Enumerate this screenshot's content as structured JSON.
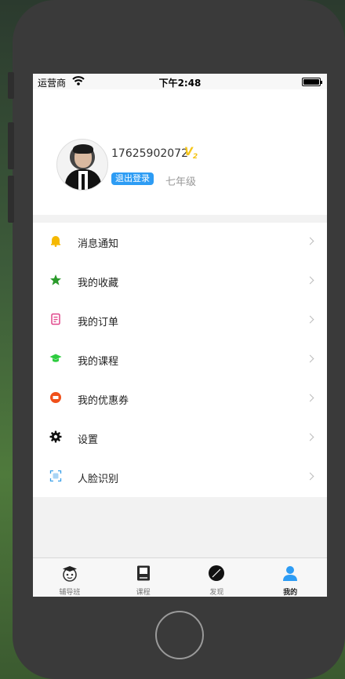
{
  "status_bar": {
    "carrier": "运营商",
    "time": "下午2:48"
  },
  "profile": {
    "phone": "17625902072",
    "vip_badge": "V",
    "vip_level": "2",
    "logout_label": "退出登录",
    "grade": "七年级"
  },
  "menu": [
    {
      "label": "消息通知",
      "icon": "bell-icon",
      "color": "#f5b800"
    },
    {
      "label": "我的收藏",
      "icon": "star-icon",
      "color": "#2a9a2a"
    },
    {
      "label": "我的订单",
      "icon": "order-icon",
      "color": "#e0458a"
    },
    {
      "label": "我的课程",
      "icon": "graduation-cap-icon",
      "color": "#2ecc40"
    },
    {
      "label": "我的优惠券",
      "icon": "coupon-icon",
      "color": "#f0501a"
    },
    {
      "label": "设置",
      "icon": "gear-icon",
      "color": "#111111"
    },
    {
      "label": "人脸识别",
      "icon": "face-scan-icon",
      "color": "#3aa0e8"
    }
  ],
  "tabbar": [
    {
      "label": "辅导班",
      "icon": "tutor-icon",
      "active": false
    },
    {
      "label": "课程",
      "icon": "book-icon",
      "active": false
    },
    {
      "label": "发现",
      "icon": "discover-icon",
      "active": false
    },
    {
      "label": "我的",
      "icon": "user-icon",
      "active": true
    }
  ],
  "colors": {
    "accent": "#2d9cf4",
    "vip": "#f5c518"
  }
}
